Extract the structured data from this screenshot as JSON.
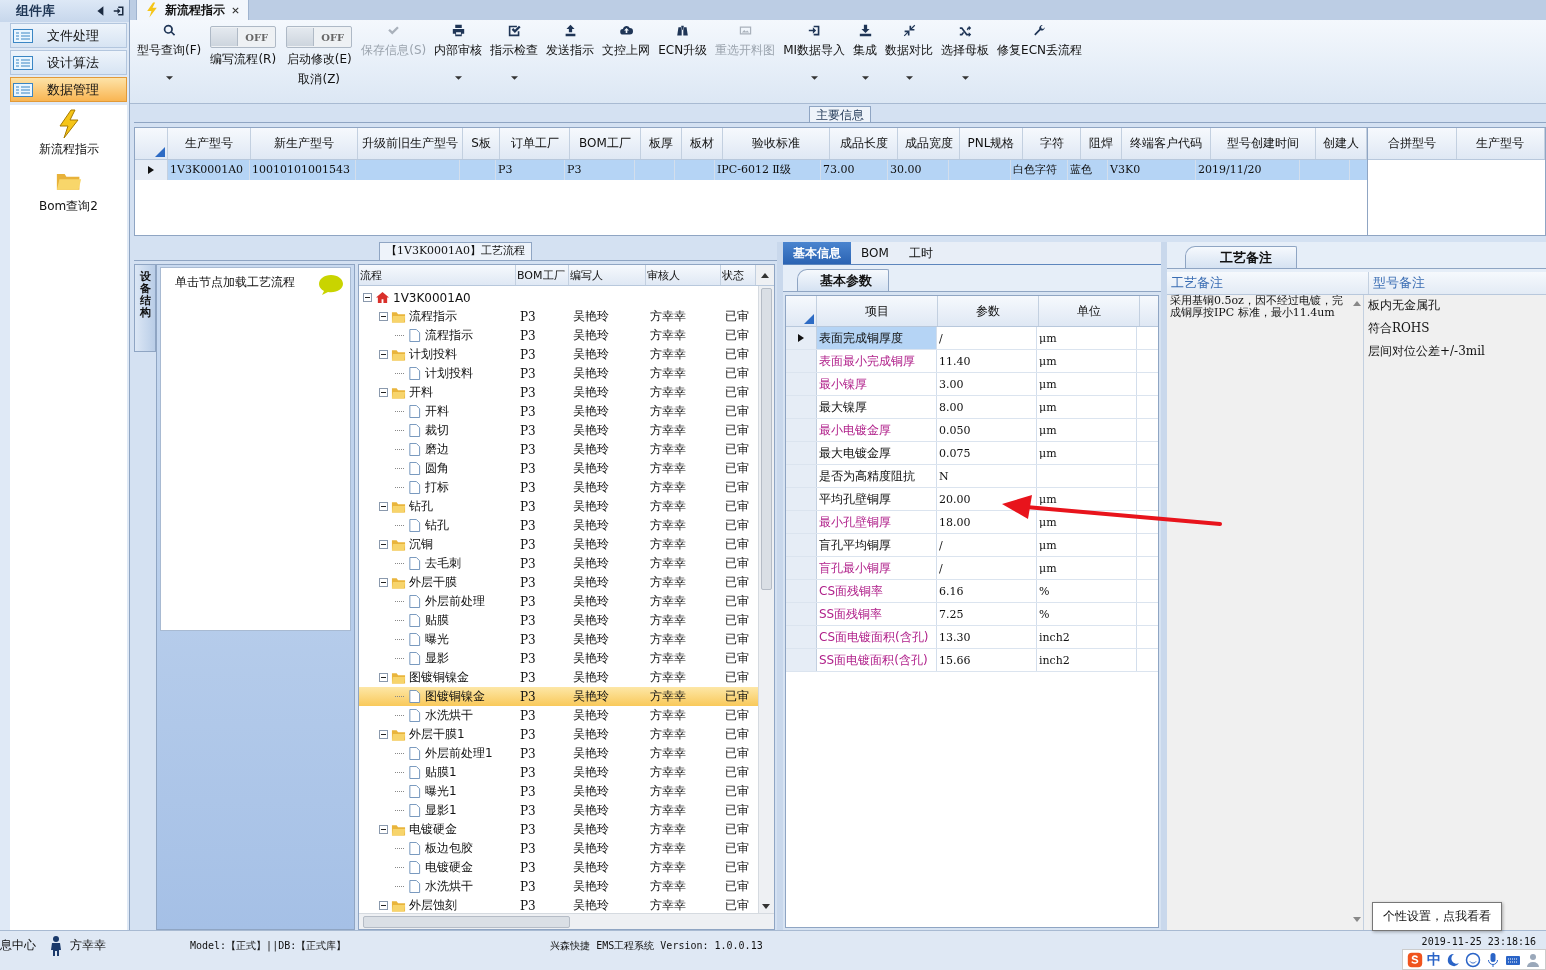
{
  "document_tab": {
    "title": "新流程指示"
  },
  "sidebar": {
    "title": "组件库",
    "categories": [
      {
        "label": "文件处理",
        "selected": false
      },
      {
        "label": "设计算法",
        "selected": false
      },
      {
        "label": "数据管理",
        "selected": true
      }
    ],
    "shortcuts": [
      {
        "label": "新流程指示"
      },
      {
        "label": "Bom查询2"
      }
    ]
  },
  "toolbar": [
    {
      "kind": "button",
      "label": "型号查询(F)",
      "dropdown": true,
      "disabled": false
    },
    {
      "kind": "toggle",
      "state_text": "OFF",
      "on": false,
      "label": "编写流程(R)"
    },
    {
      "kind": "toggle",
      "state_text": "OFF",
      "on": false,
      "label": "启动修改(E)",
      "sublabel": "取消(Z)"
    },
    {
      "kind": "button",
      "label": "保存信息(S)",
      "dropdown": false,
      "disabled": true
    },
    {
      "kind": "button",
      "label": "内部审核",
      "dropdown": true,
      "disabled": false
    },
    {
      "kind": "button",
      "label": "指示检查",
      "dropdown": true,
      "disabled": false
    },
    {
      "kind": "button",
      "label": "发送指示",
      "dropdown": false,
      "disabled": false
    },
    {
      "kind": "button",
      "label": "文控上网",
      "dropdown": false,
      "disabled": false
    },
    {
      "kind": "button",
      "label": "ECN升级",
      "dropdown": false,
      "disabled": false
    },
    {
      "kind": "button",
      "label": "重选开料图",
      "dropdown": false,
      "disabled": true
    },
    {
      "kind": "button",
      "label": "MI数据导入",
      "dropdown": true,
      "disabled": false
    },
    {
      "kind": "button",
      "label": "集成",
      "dropdown": true,
      "disabled": false
    },
    {
      "kind": "button",
      "label": "数据对比",
      "dropdown": true,
      "disabled": false
    },
    {
      "kind": "button",
      "label": "选择母板",
      "dropdown": true,
      "disabled": false
    },
    {
      "kind": "button",
      "label": "修复ECN丢流程",
      "dropdown": false,
      "disabled": false
    }
  ],
  "main_info": {
    "title": "主要信息",
    "table": {
      "columns": [
        "生产型号",
        "新生产型号",
        "升级前旧生产型号",
        "S板",
        "订单工厂",
        "BOM工厂",
        "板厚",
        "板材",
        "验收标准",
        "成品长度",
        "成品宽度",
        "PNL规格",
        "字符",
        "阻焊",
        "终端客户代码",
        "型号创建时间",
        "创建人"
      ],
      "rows": [
        {
          "selected": true,
          "cells": [
            "1V3K0001A0",
            "10010101001543",
            null,
            null,
            "P3",
            "P3",
            null,
            null,
            "IPC-6012 Ⅱ级",
            "73.00",
            "30.00",
            null,
            "白色字符",
            "蓝色",
            "V3K0",
            "2019/11/20",
            null
          ]
        }
      ]
    },
    "merge_table": {
      "columns": [
        "合拼型号",
        "生产型号"
      ]
    }
  },
  "process_flow": {
    "title": "【1V3K0001A0】工艺流程",
    "side_tab": "设备结构",
    "hint": "单击节点加载工艺流程",
    "tree": {
      "columns": [
        "流程",
        "BOM工厂",
        "编写人",
        "审核人",
        "状态"
      ],
      "nodes": [
        {
          "kind": "root",
          "name": "1V3K0001A0",
          "expanded": true,
          "selected": false,
          "children": [
            {
              "kind": "group",
              "name": "流程指示",
              "bom": "P3",
              "writer": "吴艳玲",
              "reviewer": "方幸幸",
              "status": "已审",
              "expanded": true,
              "selected": false,
              "children": [
                {
                  "kind": "step",
                  "name": "流程指示",
                  "bom": "P3",
                  "writer": "吴艳玲",
                  "reviewer": "方幸幸",
                  "status": "已审",
                  "selected": false
                }
              ]
            },
            {
              "kind": "group",
              "name": "计划投料",
              "bom": "P3",
              "writer": "吴艳玲",
              "reviewer": "方幸幸",
              "status": "已审",
              "expanded": true,
              "selected": false,
              "children": [
                {
                  "kind": "step",
                  "name": "计划投料",
                  "bom": "P3",
                  "writer": "吴艳玲",
                  "reviewer": "方幸幸",
                  "status": "已审",
                  "selected": false
                }
              ]
            },
            {
              "kind": "group",
              "name": "开料",
              "bom": "P3",
              "writer": "吴艳玲",
              "reviewer": "方幸幸",
              "status": "已审",
              "expanded": true,
              "selected": false,
              "children": [
                {
                  "kind": "step",
                  "name": "开料",
                  "bom": "P3",
                  "writer": "吴艳玲",
                  "reviewer": "方幸幸",
                  "status": "已审",
                  "selected": false
                },
                {
                  "kind": "step",
                  "name": "裁切",
                  "bom": "P3",
                  "writer": "吴艳玲",
                  "reviewer": "方幸幸",
                  "status": "已审",
                  "selected": false
                },
                {
                  "kind": "step",
                  "name": "磨边",
                  "bom": "P3",
                  "writer": "吴艳玲",
                  "reviewer": "方幸幸",
                  "status": "已审",
                  "selected": false
                },
                {
                  "kind": "step",
                  "name": "圆角",
                  "bom": "P3",
                  "writer": "吴艳玲",
                  "reviewer": "方幸幸",
                  "status": "已审",
                  "selected": false
                },
                {
                  "kind": "step",
                  "name": "打标",
                  "bom": "P3",
                  "writer": "吴艳玲",
                  "reviewer": "方幸幸",
                  "status": "已审",
                  "selected": false
                }
              ]
            },
            {
              "kind": "group",
              "name": "钻孔",
              "bom": "P3",
              "writer": "吴艳玲",
              "reviewer": "方幸幸",
              "status": "已审",
              "expanded": true,
              "selected": false,
              "children": [
                {
                  "kind": "step",
                  "name": "钻孔",
                  "bom": "P3",
                  "writer": "吴艳玲",
                  "reviewer": "方幸幸",
                  "status": "已审",
                  "selected": false
                }
              ]
            },
            {
              "kind": "group",
              "name": "沉铜",
              "bom": "P3",
              "writer": "吴艳玲",
              "reviewer": "方幸幸",
              "status": "已审",
              "expanded": true,
              "selected": false,
              "children": [
                {
                  "kind": "step",
                  "name": "去毛刺",
                  "bom": "P3",
                  "writer": "吴艳玲",
                  "reviewer": "方幸幸",
                  "status": "已审",
                  "selected": false
                }
              ]
            },
            {
              "kind": "group",
              "name": "外层干膜",
              "bom": "P3",
              "writer": "吴艳玲",
              "reviewer": "方幸幸",
              "status": "已审",
              "expanded": true,
              "selected": false,
              "children": [
                {
                  "kind": "step",
                  "name": "外层前处理",
                  "bom": "P3",
                  "writer": "吴艳玲",
                  "reviewer": "方幸幸",
                  "status": "已审",
                  "selected": false
                },
                {
                  "kind": "step",
                  "name": "贴膜",
                  "bom": "P3",
                  "writer": "吴艳玲",
                  "reviewer": "方幸幸",
                  "status": "已审",
                  "selected": false
                },
                {
                  "kind": "step",
                  "name": "曝光",
                  "bom": "P3",
                  "writer": "吴艳玲",
                  "reviewer": "方幸幸",
                  "status": "已审",
                  "selected": false
                },
                {
                  "kind": "step",
                  "name": "显影",
                  "bom": "P3",
                  "writer": "吴艳玲",
                  "reviewer": "方幸幸",
                  "status": "已审",
                  "selected": false
                }
              ]
            },
            {
              "kind": "group",
              "name": "图镀铜镍金",
              "bom": "P3",
              "writer": "吴艳玲",
              "reviewer": "方幸幸",
              "status": "已审",
              "expanded": true,
              "selected": false,
              "children": [
                {
                  "kind": "step",
                  "name": "图镀铜镍金",
                  "bom": "P3",
                  "writer": "吴艳玲",
                  "reviewer": "方幸幸",
                  "status": "已审",
                  "selected": true
                },
                {
                  "kind": "step",
                  "name": "水洗烘干",
                  "bom": "P3",
                  "writer": "吴艳玲",
                  "reviewer": "方幸幸",
                  "status": "已审",
                  "selected": false
                }
              ]
            },
            {
              "kind": "group",
              "name": "外层干膜1",
              "bom": "P3",
              "writer": "吴艳玲",
              "reviewer": "方幸幸",
              "status": "已审",
              "expanded": true,
              "selected": false,
              "children": [
                {
                  "kind": "step",
                  "name": "外层前处理1",
                  "bom": "P3",
                  "writer": "吴艳玲",
                  "reviewer": "方幸幸",
                  "status": "已审",
                  "selected": false
                },
                {
                  "kind": "step",
                  "name": "贴膜1",
                  "bom": "P3",
                  "writer": "吴艳玲",
                  "reviewer": "方幸幸",
                  "status": "已审",
                  "selected": false
                },
                {
                  "kind": "step",
                  "name": "曝光1",
                  "bom": "P3",
                  "writer": "吴艳玲",
                  "reviewer": "方幸幸",
                  "status": "已审",
                  "selected": false
                },
                {
                  "kind": "step",
                  "name": "显影1",
                  "bom": "P3",
                  "writer": "吴艳玲",
                  "reviewer": "方幸幸",
                  "status": "已审",
                  "selected": false
                }
              ]
            },
            {
              "kind": "group",
              "name": "电镀硬金",
              "bom": "P3",
              "writer": "吴艳玲",
              "reviewer": "方幸幸",
              "status": "已审",
              "expanded": true,
              "selected": false,
              "children": [
                {
                  "kind": "step",
                  "name": "板边包胶",
                  "bom": "P3",
                  "writer": "吴艳玲",
                  "reviewer": "方幸幸",
                  "status": "已审",
                  "selected": false
                },
                {
                  "kind": "step",
                  "name": "电镀硬金",
                  "bom": "P3",
                  "writer": "吴艳玲",
                  "reviewer": "方幸幸",
                  "status": "已审",
                  "selected": false
                },
                {
                  "kind": "step",
                  "name": "水洗烘干",
                  "bom": "P3",
                  "writer": "吴艳玲",
                  "reviewer": "方幸幸",
                  "status": "已审",
                  "selected": false
                }
              ]
            },
            {
              "kind": "group",
              "name": "外层蚀刻",
              "bom": "P3",
              "writer": "吴艳玲",
              "reviewer": "方幸幸",
              "status": "已审",
              "expanded": true,
              "selected": false
            }
          ]
        }
      ]
    }
  },
  "details": {
    "tabs": [
      {
        "label": "基本信息",
        "selected": true
      },
      {
        "label": "BOM",
        "selected": false
      },
      {
        "label": "工时",
        "selected": false
      }
    ],
    "params": {
      "tab": "基本参数",
      "columns": [
        "项目",
        "参数",
        "单位"
      ],
      "rows": [
        {
          "item": "表面完成铜厚度",
          "value": "/",
          "unit": "μm",
          "required": false,
          "selected": true
        },
        {
          "item": "表面最小完成铜厚",
          "value": "11.40",
          "unit": "μm",
          "required": true,
          "selected": false
        },
        {
          "item": "最小镍厚",
          "value": "3.00",
          "unit": "μm",
          "required": true,
          "selected": false
        },
        {
          "item": "最大镍厚",
          "value": "8.00",
          "unit": "μm",
          "required": false,
          "selected": false
        },
        {
          "item": "最小电镀金厚",
          "value": "0.050",
          "unit": "μm",
          "required": true,
          "selected": false
        },
        {
          "item": "最大电镀金厚",
          "value": "0.075",
          "unit": "μm",
          "required": false,
          "selected": false
        },
        {
          "item": "是否为高精度阻抗",
          "value": "N",
          "required": false,
          "selected": false
        },
        {
          "item": "平均孔壁铜厚",
          "value": "20.00",
          "unit": "μm",
          "required": false,
          "selected": false
        },
        {
          "item": "最小孔壁铜厚",
          "value": "18.00",
          "unit": "μm",
          "required": true,
          "selected": false
        },
        {
          "item": "盲孔平均铜厚",
          "value": "/",
          "unit": "μm",
          "required": false,
          "selected": false
        },
        {
          "item": "盲孔最小铜厚",
          "value": "/",
          "unit": "μm",
          "required": true,
          "selected": false
        },
        {
          "item": "CS面残铜率",
          "value": "6.16",
          "unit": "%",
          "required": true,
          "selected": false
        },
        {
          "item": "SS面残铜率",
          "value": "7.25",
          "unit": "%",
          "required": true,
          "selected": false
        },
        {
          "item": "CS面电镀面积(含孔)",
          "value": "13.30",
          "unit": "inch2",
          "required": true,
          "selected": false
        },
        {
          "item": "SS面电镀面积(含孔)",
          "value": "15.66",
          "unit": "inch2",
          "required": true,
          "selected": false
        }
      ]
    },
    "notes": {
      "tab": "工艺备注",
      "columns": [
        "工艺备注",
        "型号备注"
      ],
      "process_note": "采用基铜0.5oz，因不经过电镀，完成铜厚按IPC 标准，最小11.4um",
      "model_notes": [
        "板内无金属孔",
        "符合ROHS",
        "层间对位公差+/-3mil"
      ]
    }
  },
  "annotations": [
    {
      "kind": "arrow"
    }
  ],
  "status_bar": {
    "left_label": "息中心",
    "user": "方幸幸",
    "db_info": "Model:【正式】||DB:【正式库】",
    "app_info": "兴森快捷 EMS工程系统 Version: 1.0.0.13",
    "datetime": "2019-11-25 23:18:16"
  },
  "tooltip": {
    "text": "个性设置，点我看看"
  },
  "ime_bar": {
    "label": "中"
  }
}
